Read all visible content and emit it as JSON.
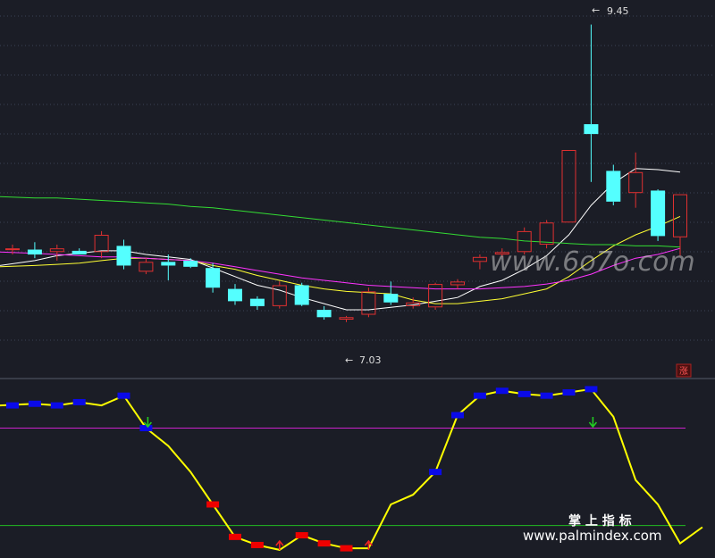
{
  "chart_data": {
    "type": "candlestick",
    "price_range": [
      6.6,
      9.65
    ],
    "high_label": "9.45",
    "low_label": "7.03",
    "high_marker": "←",
    "low_marker": "←",
    "candles": [
      {
        "o": 7.62,
        "h": 7.66,
        "l": 7.58,
        "c": 7.63
      },
      {
        "o": 7.62,
        "h": 7.68,
        "l": 7.55,
        "c": 7.58
      },
      {
        "o": 7.6,
        "h": 7.66,
        "l": 7.53,
        "c": 7.63
      },
      {
        "o": 7.61,
        "h": 7.63,
        "l": 7.58,
        "c": 7.58
      },
      {
        "o": 7.6,
        "h": 7.77,
        "l": 7.55,
        "c": 7.74
      },
      {
        "o": 7.65,
        "h": 7.7,
        "l": 7.46,
        "c": 7.49
      },
      {
        "o": 7.44,
        "h": 7.55,
        "l": 7.42,
        "c": 7.52
      },
      {
        "o": 7.52,
        "h": 7.58,
        "l": 7.37,
        "c": 7.49
      },
      {
        "o": 7.53,
        "h": 7.55,
        "l": 7.47,
        "c": 7.48
      },
      {
        "o": 7.47,
        "h": 7.51,
        "l": 7.27,
        "c": 7.31
      },
      {
        "o": 7.3,
        "h": 7.34,
        "l": 7.17,
        "c": 7.2
      },
      {
        "o": 7.22,
        "h": 7.24,
        "l": 7.13,
        "c": 7.16
      },
      {
        "o": 7.16,
        "h": 7.36,
        "l": 7.14,
        "c": 7.33
      },
      {
        "o": 7.33,
        "h": 7.35,
        "l": 7.16,
        "c": 7.17
      },
      {
        "o": 7.13,
        "h": 7.16,
        "l": 7.05,
        "c": 7.07
      },
      {
        "o": 7.05,
        "h": 7.08,
        "l": 7.03,
        "c": 7.07
      },
      {
        "o": 7.09,
        "h": 7.31,
        "l": 7.07,
        "c": 7.28
      },
      {
        "o": 7.26,
        "h": 7.36,
        "l": 7.17,
        "c": 7.19
      },
      {
        "o": 7.16,
        "h": 7.23,
        "l": 7.14,
        "c": 7.19
      },
      {
        "o": 7.15,
        "h": 7.35,
        "l": 7.13,
        "c": 7.34
      },
      {
        "o": 7.33,
        "h": 7.38,
        "l": 7.3,
        "c": 7.36
      },
      {
        "o": 7.52,
        "h": 7.58,
        "l": 7.46,
        "c": 7.56
      },
      {
        "o": 7.58,
        "h": 7.63,
        "l": 7.56,
        "c": 7.6
      },
      {
        "o": 7.6,
        "h": 7.8,
        "l": 7.58,
        "c": 7.77
      },
      {
        "o": 7.66,
        "h": 7.86,
        "l": 7.63,
        "c": 7.84
      },
      {
        "o": 7.84,
        "h": 8.43,
        "l": 7.84,
        "c": 8.43
      },
      {
        "o": 8.64,
        "h": 9.45,
        "l": 8.17,
        "c": 8.56
      },
      {
        "o": 8.26,
        "h": 8.31,
        "l": 7.98,
        "c": 8.01
      },
      {
        "o": 8.08,
        "h": 8.41,
        "l": 7.96,
        "c": 8.25
      },
      {
        "o": 8.1,
        "h": 8.11,
        "l": 7.69,
        "c": 7.73
      },
      {
        "o": 7.72,
        "h": 8.07,
        "l": 7.57,
        "c": 8.07
      }
    ],
    "ma_lines": [
      {
        "color": "#ffffff",
        "values": [
          7.49,
          7.53,
          7.57,
          7.59,
          7.61,
          7.61,
          7.58,
          7.56,
          7.54,
          7.47,
          7.4,
          7.33,
          7.29,
          7.23,
          7.18,
          7.13,
          7.13,
          7.15,
          7.17,
          7.2,
          7.23,
          7.32,
          7.37,
          7.46,
          7.57,
          7.74,
          7.98,
          8.16,
          8.28,
          8.27,
          8.25
        ]
      },
      {
        "color": "#ffff33",
        "values": [
          7.48,
          7.49,
          7.5,
          7.51,
          7.53,
          7.55,
          7.55,
          7.54,
          7.53,
          7.49,
          7.46,
          7.41,
          7.37,
          7.33,
          7.3,
          7.28,
          7.27,
          7.26,
          7.21,
          7.18,
          7.18,
          7.2,
          7.22,
          7.26,
          7.3,
          7.4,
          7.53,
          7.65,
          7.74,
          7.81,
          7.89
        ]
      },
      {
        "color": "#ff33ff",
        "values": [
          7.6,
          7.59,
          7.58,
          7.57,
          7.56,
          7.56,
          7.55,
          7.54,
          7.53,
          7.51,
          7.48,
          7.45,
          7.42,
          7.39,
          7.37,
          7.35,
          7.33,
          7.32,
          7.31,
          7.3,
          7.3,
          7.3,
          7.31,
          7.32,
          7.34,
          7.37,
          7.42,
          7.49,
          7.55,
          7.58,
          7.63
        ]
      },
      {
        "color": "#33dd33",
        "values": [
          8.05,
          8.04,
          8.04,
          8.03,
          8.02,
          8.01,
          8.0,
          7.99,
          7.97,
          7.96,
          7.94,
          7.92,
          7.9,
          7.88,
          7.86,
          7.84,
          7.82,
          7.8,
          7.78,
          7.76,
          7.74,
          7.72,
          7.71,
          7.69,
          7.68,
          7.67,
          7.66,
          7.66,
          7.65,
          7.65,
          7.64
        ]
      }
    ],
    "tag_label": "涨",
    "oscillator": {
      "range": [
        -5,
        105
      ],
      "upper_level": 75,
      "lower_level": 15,
      "values": [
        89,
        90,
        89,
        91,
        89,
        95,
        75,
        64,
        48,
        28,
        8,
        3,
        0,
        9,
        4,
        1,
        1,
        28,
        34,
        48,
        83,
        95,
        98,
        96,
        95,
        97,
        99,
        82,
        43,
        28,
        4,
        14
      ],
      "blue_markers": [
        0,
        1,
        2,
        3,
        5,
        6,
        19,
        20,
        21,
        22,
        23,
        24,
        25,
        26
      ],
      "red_markers": [
        9,
        10,
        11,
        13,
        14,
        15
      ],
      "down_arrows": [
        6,
        26
      ],
      "up_arrows": [
        12,
        16
      ]
    }
  },
  "watermark": {
    "domain": "www.6o7o.com",
    "brand": "掌 上 指 标",
    "site": "www.palmindex.com"
  },
  "colors": {
    "background": "#1b1d26",
    "grid": "#3b4255",
    "up_candle": "#e03030",
    "down_candle": "#54ffff",
    "osc_line": "#ffff00",
    "blue_marker": "#0a0ae8",
    "red_marker": "#ee0000"
  }
}
